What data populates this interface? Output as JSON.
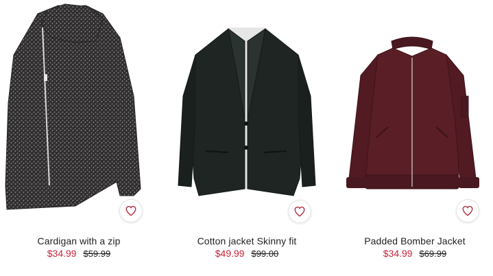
{
  "colors": {
    "sale_price": "#c8243a",
    "heart_icon": "#b0243a",
    "text": "#222222"
  },
  "products": [
    {
      "name": "Cardigan with a zip",
      "sale_price": "$34.99",
      "original_price": "$59.99",
      "image_icon": "cardigan-image",
      "garment_color": "#3a3838"
    },
    {
      "name": "Cotton jacket Skinny fit",
      "sale_price": "$49.99",
      "original_price": "$99.00",
      "image_icon": "blazer-image",
      "garment_color": "#1f2624"
    },
    {
      "name": "Padded Bomber Jacket",
      "sale_price": "$34.99",
      "original_price": "$69.99",
      "image_icon": "bomber-jacket-image",
      "garment_color": "#5a1e26"
    }
  ]
}
